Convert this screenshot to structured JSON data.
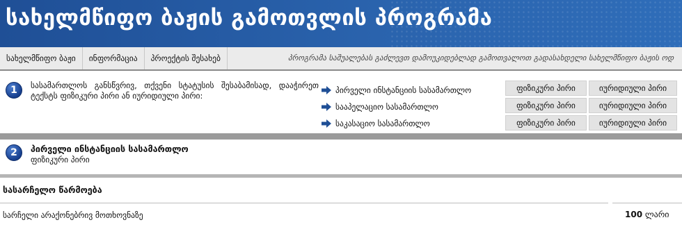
{
  "header": {
    "title": "სახელმწიფო ბაჟის გამოთვლის პროგრამა"
  },
  "nav": {
    "items": [
      {
        "label": "სახელმწიფო ბაჟი"
      },
      {
        "label": "ინფორმაცია"
      },
      {
        "label": "პროექტის შესახებ"
      }
    ],
    "tagline": "პროგრამა საშუალებას გაძლევთ დამოუკიდებლად გამოთვალოთ გადასახდელი სახელმწიფო ბაჟის ოდ"
  },
  "step1": {
    "number": "1",
    "instruction": "სასამართლოს განსწვრივ, თქვენი სტატუსის შესაბამისად, დააჭირეთ ტექსტს ფიზიკური პირი ან იურიდიული პირი:",
    "courts": [
      {
        "label": "პირველი ინსტანციის სასამართლო"
      },
      {
        "label": "სააპელაციო სასამართლო"
      },
      {
        "label": "საკასაციო სასამართლო"
      }
    ],
    "buttons": {
      "physical": "ფიზიკური პირი",
      "legal": "იურიდიული პირი"
    }
  },
  "step2": {
    "number": "2",
    "title": "პირველი ინსტანციის სასამართლო",
    "subtitle": "ფიზიკური პირი"
  },
  "section": {
    "title": "სასარჩელო წარმოება"
  },
  "fee": {
    "label": "სარჩელი არაქონებრივ მოთხოვნაზე",
    "amount": "100",
    "currency": "ლარი"
  },
  "colors": {
    "banner": "#2a63ad",
    "badge": "#173f8e",
    "arrow": "#1f4f96"
  }
}
